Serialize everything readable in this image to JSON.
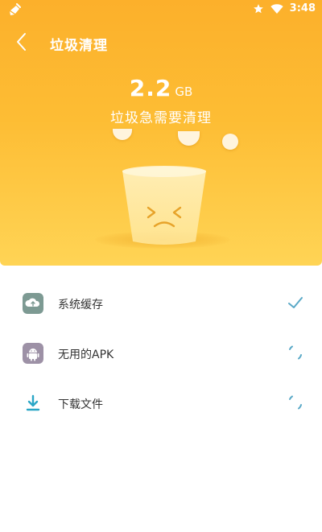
{
  "status_bar": {
    "time": "3:48",
    "left_icon": "broom-icon",
    "icons": [
      "star-icon",
      "wifi-icon"
    ]
  },
  "app_bar": {
    "title": "垃圾清理",
    "back_icon": "back-chevron-icon"
  },
  "summary": {
    "size_value": "2.2",
    "size_unit": "GB",
    "message": "垃圾急需要清理"
  },
  "illustration": {
    "cup_icon": "sad-trash-cup-icon"
  },
  "items": [
    {
      "label": "系统缓存",
      "icon": "cloud-cache-icon",
      "icon_color": "#7d9a93",
      "status": "done",
      "status_icon": "check-icon"
    },
    {
      "label": "无用的APK",
      "icon": "android-icon",
      "icon_color": "#9d91a6",
      "status": "scanning",
      "status_icon": "loading-spinner-icon"
    },
    {
      "label": "下载文件",
      "icon": "download-icon",
      "icon_color": "#2aa6c6",
      "status": "scanning",
      "status_icon": "loading-spinner-icon"
    }
  ],
  "colors": {
    "header_top": "#fcb02b",
    "header_bottom": "#ffd455",
    "status_accent": "#5aa9c7"
  }
}
